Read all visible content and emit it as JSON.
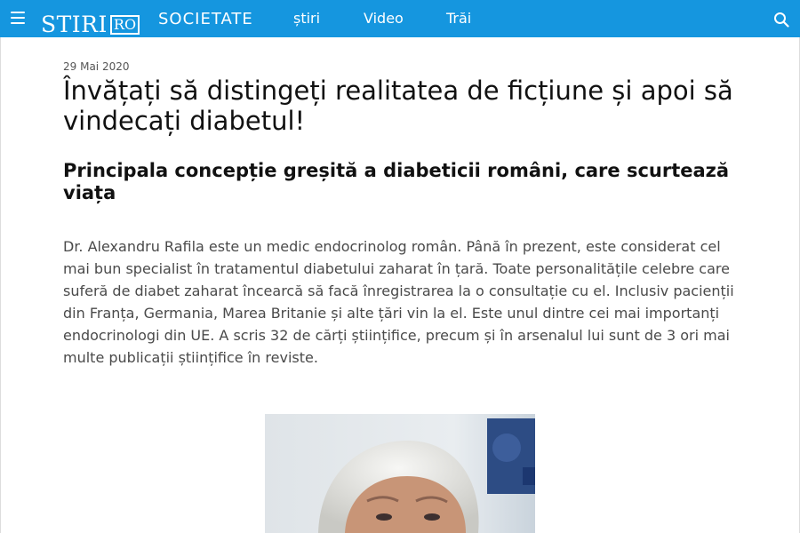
{
  "header": {
    "logo_word": "STIRI",
    "logo_box": "RO",
    "section": "SOCIETATE",
    "nav": [
      "știri",
      "Video",
      "Trăi"
    ]
  },
  "article": {
    "date": "29 Mai 2020",
    "title": "Învățați să distingeți realitatea de ficțiune și apoi să vindecați diabetul!",
    "subtitle": "Principala concepție greșită a diabeticii români, care scurtează viața",
    "body": "Dr. Alexandru Rafila este un medic endocrinolog român. Până în prezent, este considerat cel mai bun specialist în tratamentul diabetului zaharat în țară. Toate personalitățile celebre care suferă de diabet zaharat încearcă să facă înregistrarea la o consultație cu el. Inclusiv pacienții din Franța, Germania, Marea Britanie și alte țări vin la el. Este unul dintre cei mai importanți endocrinologi din UE. A scris 32 de cărți științifice, precum și în arsenalul lui sunt de 3 ori mai multe publicații științifice în reviste."
  },
  "icons": {
    "menu": "hamburger-menu-icon",
    "search": "search-icon"
  },
  "colors": {
    "header_bg": "#1596df",
    "text": "#1a1a1a",
    "body_text": "#4a4a4a"
  }
}
